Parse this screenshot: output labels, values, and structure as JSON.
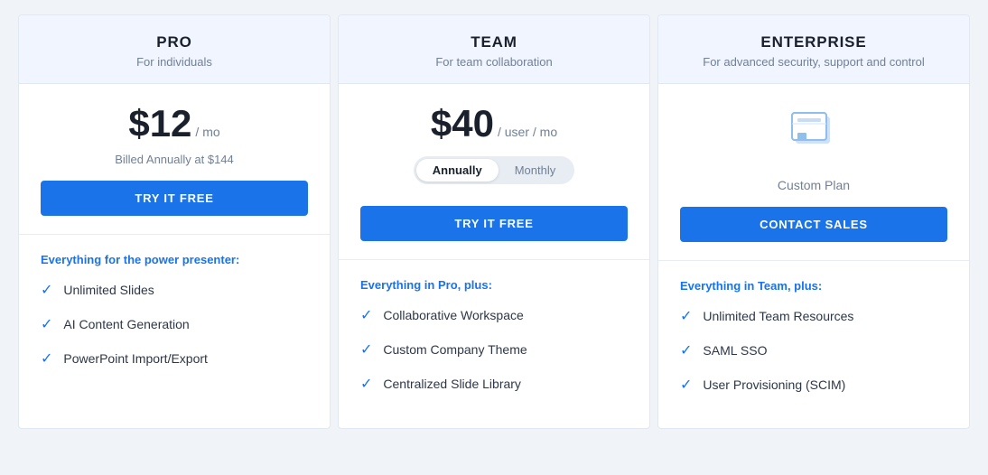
{
  "plans": [
    {
      "id": "pro",
      "name": "PRO",
      "subtitle": "For individuals",
      "price_display": "$12",
      "price_period": "/ mo",
      "billing_note": "Billed Annually at $144",
      "cta_label": "TRY IT FREE",
      "cta_type": "try",
      "features_title": "Everything for the power presenter:",
      "features": [
        "Unlimited Slides",
        "AI Content Generation",
        "PowerPoint Import/Export"
      ]
    },
    {
      "id": "team",
      "name": "TEAM",
      "subtitle": "For team collaboration",
      "price_display": "$40",
      "price_period": "/ user / mo",
      "toggle_option_1": "Annually",
      "toggle_option_2": "Monthly",
      "toggle_active": "Annually",
      "cta_label": "TRY IT FREE",
      "cta_type": "try",
      "features_title": "Everything in Pro, plus:",
      "features": [
        "Collaborative Workspace",
        "Custom Company Theme",
        "Centralized Slide Library"
      ]
    },
    {
      "id": "enterprise",
      "name": "ENTERPRISE",
      "subtitle": "For advanced security, support and control",
      "custom_plan_label": "Custom Plan",
      "cta_label": "CONTACT SALES",
      "cta_type": "contact",
      "features_title": "Everything in Team, plus:",
      "features": [
        "Unlimited Team Resources",
        "SAML SSO",
        "User Provisioning (SCIM)"
      ]
    }
  ],
  "colors": {
    "accent": "#1a73e8",
    "header_bg": "#f0f5ff",
    "text_primary": "#1a202c",
    "text_secondary": "#718096"
  }
}
